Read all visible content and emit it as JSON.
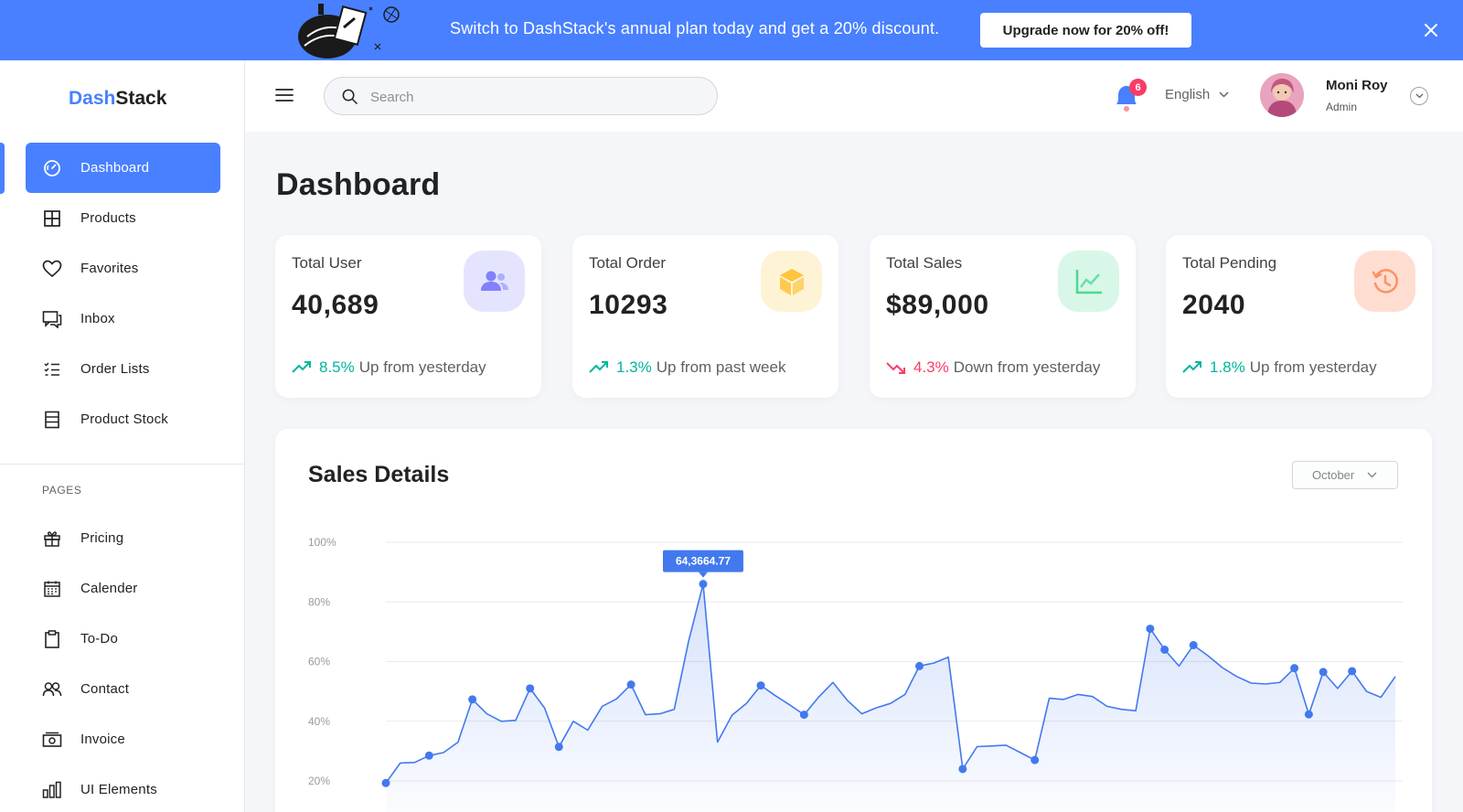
{
  "promo": {
    "text": "Switch to DashStack's annual plan today and get a 20% discount.",
    "button_label": "Upgrade now for 20% off!",
    "close_icon": "close-icon"
  },
  "brand": {
    "name_accent": "Dash",
    "name_rest": "Stack"
  },
  "sidebar": {
    "items": [
      {
        "label": "Dashboard",
        "icon": "dashboard-gauge-icon",
        "active": true
      },
      {
        "label": "Products",
        "icon": "grid-icon"
      },
      {
        "label": "Favorites",
        "icon": "heart-icon"
      },
      {
        "label": "Inbox",
        "icon": "chat-icon"
      },
      {
        "label": "Order Lists",
        "icon": "list-icon"
      },
      {
        "label": "Product Stock",
        "icon": "stock-icon"
      }
    ],
    "pages_heading": "PAGES",
    "pages": [
      {
        "label": "Pricing",
        "icon": "gift-icon"
      },
      {
        "label": "Calender",
        "icon": "calendar-icon"
      },
      {
        "label": "To-Do",
        "icon": "clipboard-icon"
      },
      {
        "label": "Contact",
        "icon": "contact-icon"
      },
      {
        "label": "Invoice",
        "icon": "invoice-icon"
      },
      {
        "label": "UI Elements",
        "icon": "bar-chart-icon"
      }
    ]
  },
  "header": {
    "search_placeholder": "Search",
    "notification_count": "6",
    "language": "English",
    "user_name": "Moni Roy",
    "user_role": "Admin"
  },
  "page_title": "Dashboard",
  "cards": [
    {
      "title": "Total User",
      "value": "40,689",
      "trend_value": "8.5%",
      "trend_text": "Up from yesterday",
      "direction": "up",
      "icon": "users-icon",
      "icon_bg": "#E5E4FF",
      "icon_color": "#8280FF"
    },
    {
      "title": "Total Order",
      "value": "10293",
      "trend_value": "1.3%",
      "trend_text": "Up from past week",
      "direction": "up",
      "icon": "box-icon",
      "icon_bg": "#FFF3D6",
      "icon_color": "#FEC53D"
    },
    {
      "title": "Total Sales",
      "value": "$89,000",
      "trend_value": "4.3%",
      "trend_text": "Down from yesterday",
      "direction": "down",
      "icon": "line-chart-icon",
      "icon_bg": "#D9F7E8",
      "icon_color": "#4AD991"
    },
    {
      "title": "Total Pending",
      "value": "2040",
      "trend_value": "1.8%",
      "trend_text": "Up from yesterday",
      "direction": "up",
      "icon": "history-icon",
      "icon_bg": "#FFDED1",
      "icon_color": "#FF9066"
    }
  ],
  "sales": {
    "title": "Sales Details",
    "month": "October"
  },
  "chart_data": {
    "type": "area",
    "title": "Sales Details",
    "y_ticks": [
      "100%",
      "80%",
      "60%",
      "40%",
      "20%"
    ],
    "ylim": [
      20,
      100
    ],
    "grid": true,
    "color": "#4379EE",
    "tooltip": {
      "label": "64,3664.77",
      "index": 22
    },
    "points": [
      [
        0,
        19.3
      ],
      [
        1,
        26
      ],
      [
        2,
        26.2
      ],
      [
        3,
        28.5
      ],
      [
        4,
        29.5
      ],
      [
        5,
        33
      ],
      [
        6,
        47.3
      ],
      [
        7,
        42.5
      ],
      [
        8,
        40
      ],
      [
        9,
        40.3
      ],
      [
        10,
        51
      ],
      [
        11,
        44.5
      ],
      [
        12,
        31.4
      ],
      [
        13,
        40
      ],
      [
        14,
        37
      ],
      [
        15,
        45
      ],
      [
        16,
        47.5
      ],
      [
        17,
        52.3
      ],
      [
        18,
        42.2
      ],
      [
        19,
        42.5
      ],
      [
        20,
        44
      ],
      [
        21,
        67
      ],
      [
        22,
        86
      ],
      [
        23,
        33
      ],
      [
        24,
        42
      ],
      [
        25,
        46
      ],
      [
        26,
        52
      ],
      [
        27,
        48.6
      ],
      [
        28,
        45.5
      ],
      [
        29,
        42.2
      ],
      [
        30,
        48
      ],
      [
        31,
        53
      ],
      [
        32,
        47
      ],
      [
        33,
        42.5
      ],
      [
        34,
        44.5
      ],
      [
        35,
        46
      ],
      [
        36,
        49
      ],
      [
        37,
        58.5
      ],
      [
        38,
        59.5
      ],
      [
        39,
        61.5
      ],
      [
        40,
        24
      ],
      [
        41,
        31.5
      ],
      [
        42,
        31.7
      ],
      [
        43,
        32
      ],
      [
        44,
        29.5
      ],
      [
        45,
        27
      ],
      [
        46,
        47.7
      ],
      [
        47,
        47.3
      ],
      [
        48,
        49
      ],
      [
        49,
        48.3
      ],
      [
        50,
        45
      ],
      [
        51,
        44
      ],
      [
        52,
        43.5
      ],
      [
        53,
        71
      ],
      [
        54,
        64
      ],
      [
        55,
        58.5
      ],
      [
        56,
        65.5
      ],
      [
        57,
        62
      ],
      [
        58,
        58
      ],
      [
        59,
        55
      ],
      [
        60,
        52.8
      ],
      [
        61,
        52.5
      ],
      [
        62,
        53
      ],
      [
        63,
        57.8
      ],
      [
        64,
        42.3
      ],
      [
        65,
        56.5
      ],
      [
        66,
        51
      ],
      [
        67,
        56.8
      ],
      [
        68,
        50
      ],
      [
        69,
        48
      ],
      [
        70,
        55
      ]
    ],
    "markers": [
      0,
      3,
      6,
      10,
      12,
      17,
      22,
      26,
      29,
      37,
      40,
      45,
      53,
      54,
      56,
      63,
      64,
      65,
      67
    ]
  }
}
